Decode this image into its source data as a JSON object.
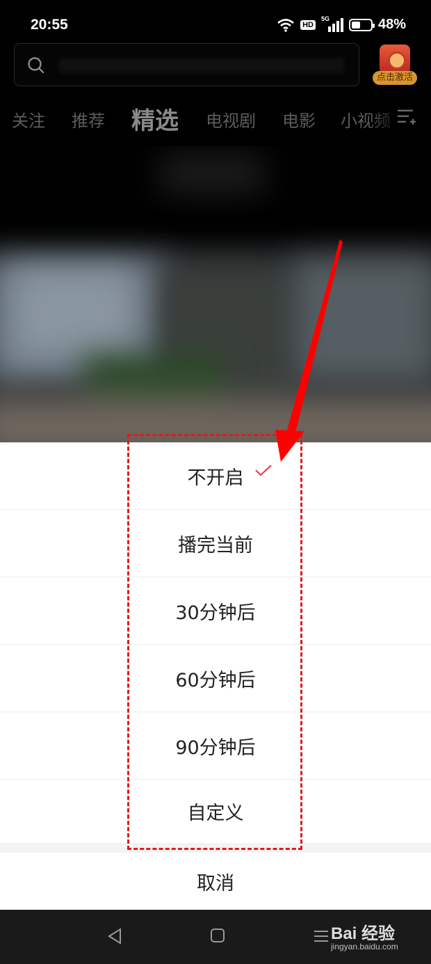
{
  "status_bar": {
    "time": "20:55",
    "network": "5G",
    "hd": "HD",
    "battery_text": "48%",
    "battery_level": 0.48
  },
  "search": {
    "placeholder": ""
  },
  "promo": {
    "label": "点击激活"
  },
  "tabs": [
    {
      "label": "关注"
    },
    {
      "label": "推荐"
    },
    {
      "label": "精选",
      "active": true
    },
    {
      "label": "电视剧"
    },
    {
      "label": "电影"
    },
    {
      "label": "小视频"
    }
  ],
  "sheet": {
    "options": [
      {
        "label": "不开启",
        "selected": true
      },
      {
        "label": "播完当前"
      },
      {
        "label": "30分钟后"
      },
      {
        "label": "60分钟后"
      },
      {
        "label": "90分钟后"
      },
      {
        "label": "自定义"
      }
    ],
    "cancel_label": "取消",
    "check_color": "#e5414d"
  },
  "annotation": {
    "highlight_color": "#e01b1b",
    "arrow_color": "#ff0000"
  },
  "watermark": {
    "brand": "Bai 经验",
    "url": "jingyan.baidu.com"
  },
  "icons": {
    "search": "search-icon",
    "wifi": "wifi-icon",
    "signal": "signal-icon",
    "battery": "battery-icon",
    "menu": "tab-menu-icon",
    "check": "check-icon",
    "back": "nav-back-icon",
    "home": "nav-home-icon",
    "recents": "nav-recents-icon"
  }
}
